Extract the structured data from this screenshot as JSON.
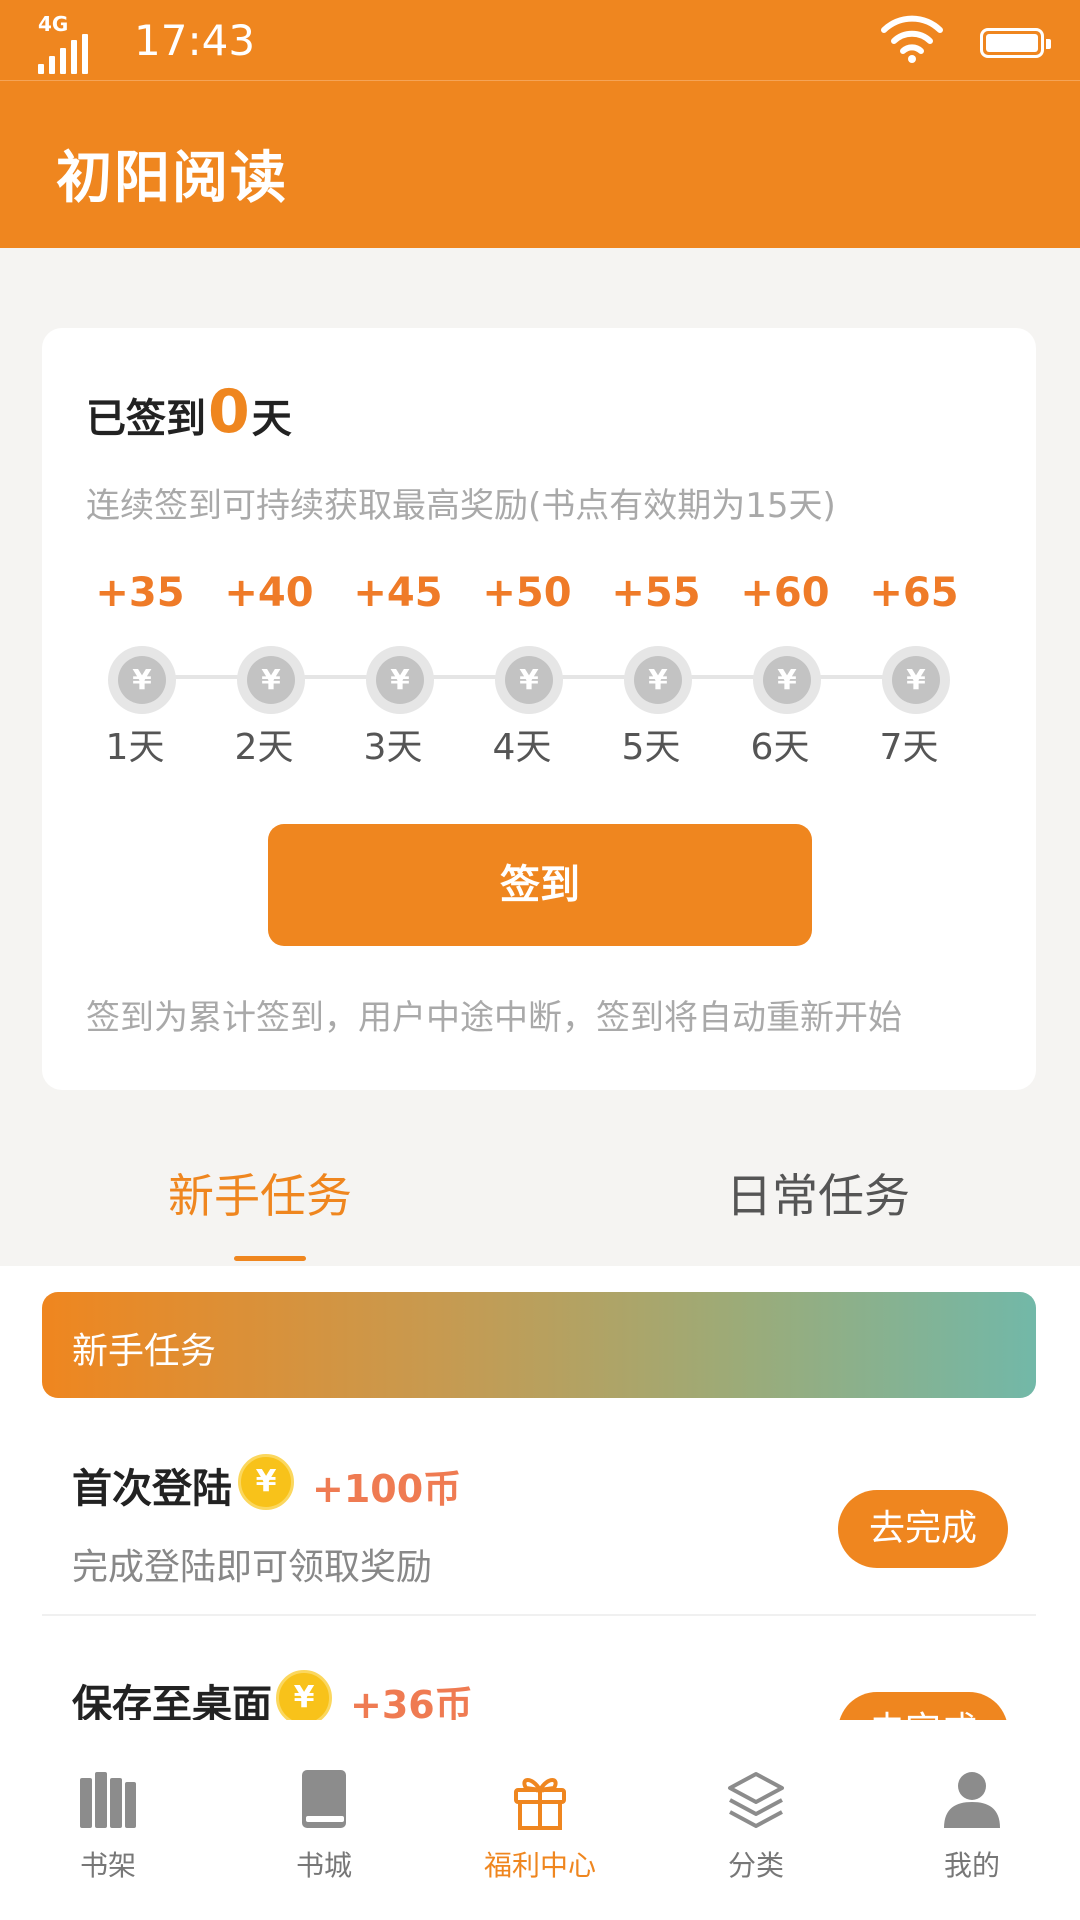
{
  "status_bar": {
    "network": "4G",
    "time": "17:43"
  },
  "app_bar": {
    "title": "初阳阅读"
  },
  "signin": {
    "prefix": "已签到",
    "count": "0",
    "suffix": "天",
    "description": "连续签到可持续获取最高奖励(书点有效期为15天)",
    "days": [
      {
        "points": "+35",
        "label": "1天"
      },
      {
        "points": "+40",
        "label": "2天"
      },
      {
        "points": "+45",
        "label": "3天"
      },
      {
        "points": "+50",
        "label": "4天"
      },
      {
        "points": "+55",
        "label": "5天"
      },
      {
        "points": "+60",
        "label": "6天"
      },
      {
        "points": "+65",
        "label": "7天"
      }
    ],
    "coin_symbol": "¥",
    "button_label": "签到",
    "note": "签到为累计签到，用户中途中断，签到将自动重新开始"
  },
  "tabs": {
    "newbie": "新手任务",
    "daily": "日常任务"
  },
  "task_section": {
    "banner_title": "新手任务",
    "coin_symbol": "¥",
    "items": [
      {
        "name": "首次登陆",
        "reward": "+100币",
        "desc": "完成登陆即可领取奖励",
        "button": "去完成"
      },
      {
        "name": "保存至桌面",
        "reward": "+36币",
        "desc": "",
        "button": "去完成"
      }
    ]
  },
  "bottom_nav": {
    "items": [
      {
        "label": "书架",
        "icon": "bookshelf-icon"
      },
      {
        "label": "书城",
        "icon": "book-icon"
      },
      {
        "label": "福利中心",
        "icon": "gift-icon"
      },
      {
        "label": "分类",
        "icon": "layers-icon"
      },
      {
        "label": "我的",
        "icon": "user-icon"
      }
    ],
    "active": "福利中心"
  },
  "colors": {
    "brand": "#ef861f",
    "reward_text": "#ef7b28",
    "coin_gold": "#f8c21a",
    "banner_gradient_end": "#72b8a8"
  }
}
